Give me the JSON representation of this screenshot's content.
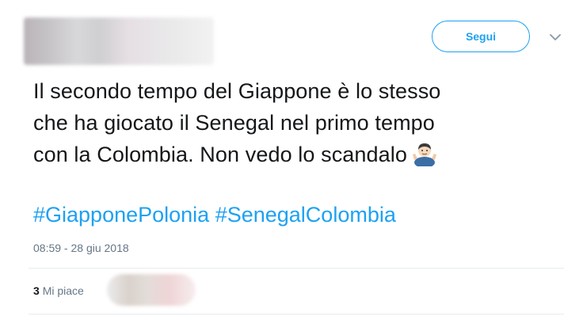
{
  "header": {
    "follow_label": "Segui",
    "menu_icon": "chevron-down-icon"
  },
  "tweet": {
    "line1": "Il secondo tempo del Giappone è lo stesso",
    "line2": "che ha giocato il Senegal nel primo tempo",
    "line3": "con la Colombia. Non vedo lo scandalo",
    "emoji": "man-shrugging-emoji",
    "hashtags": [
      "#GiapponePolonia",
      "#SenegalColombia"
    ]
  },
  "meta": {
    "timestamp": "08:59 - 28 giu 2018"
  },
  "stats": {
    "likes_count": "3",
    "likes_label": "Mi piace"
  },
  "colors": {
    "accent": "#1da1f2",
    "text": "#14171a",
    "muted": "#657786",
    "divider": "#e6ecf0"
  }
}
